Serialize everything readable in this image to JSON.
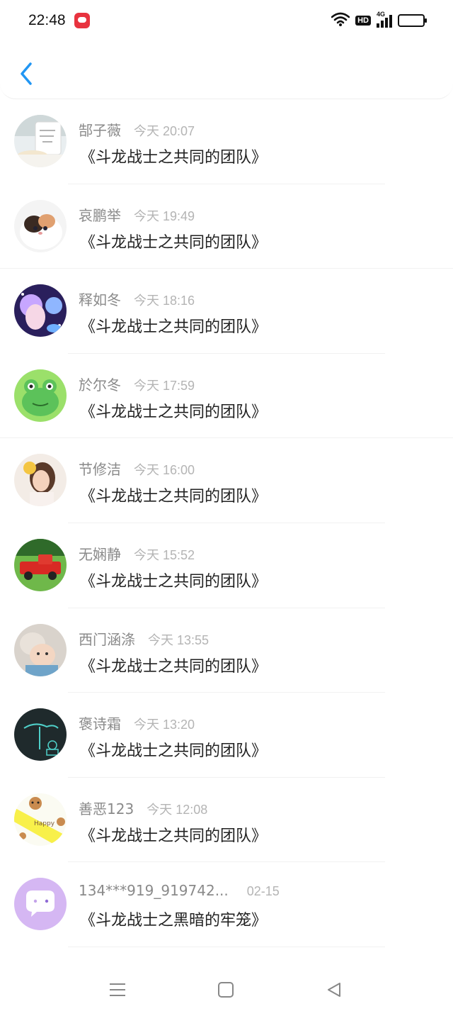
{
  "status": {
    "time": "22:48",
    "hd_label": "HD",
    "network_label": "4G"
  },
  "header": {
    "back_icon": "chevron-left-icon",
    "accent_color": "#2196f3"
  },
  "items": [
    {
      "name": "郜子薇",
      "time": "今天 20:07",
      "title": "《斗龙战士之共同的团队》",
      "avatar": "avatar-cup-photo"
    },
    {
      "name": "哀鹏举",
      "time": "今天 19:49",
      "title": "《斗龙战士之共同的团队》",
      "avatar": "avatar-kitten-photo"
    },
    {
      "name": "释如冬",
      "time": "今天 18:16",
      "title": "《斗龙战士之共同的团队》",
      "avatar": "avatar-anime-girl-moon"
    },
    {
      "name": "於尔冬",
      "time": "今天 17:59",
      "title": "《斗龙战士之共同的团队》",
      "avatar": "avatar-cartoon-frog"
    },
    {
      "name": "节修洁",
      "time": "今天 16:00",
      "title": "《斗龙战士之共同的团队》",
      "avatar": "avatar-woman-photo"
    },
    {
      "name": "无娴静",
      "time": "今天 15:52",
      "title": "《斗龙战士之共同的团队》",
      "avatar": "avatar-red-toy-truck"
    },
    {
      "name": "西门涵涤",
      "time": "今天 13:55",
      "title": "《斗龙战士之共同的团队》",
      "avatar": "avatar-baby-photo"
    },
    {
      "name": "褒诗霜",
      "time": "今天 13:20",
      "title": "《斗龙战士之共同的团队》",
      "avatar": "avatar-dark-tree-art"
    },
    {
      "name": "善恶123",
      "time": "今天 12:08",
      "title": "《斗龙战士之共同的团队》",
      "avatar": "avatar-happy-bears"
    },
    {
      "name": "134***919_919742...",
      "time": "02-15",
      "title": "《斗龙战士之黑暗的牢笼》",
      "avatar": "avatar-chat-bubble-default"
    }
  ],
  "nav": {
    "menu_icon": "menu-icon",
    "home_icon": "home-square-icon",
    "back_icon": "back-triangle-icon"
  }
}
